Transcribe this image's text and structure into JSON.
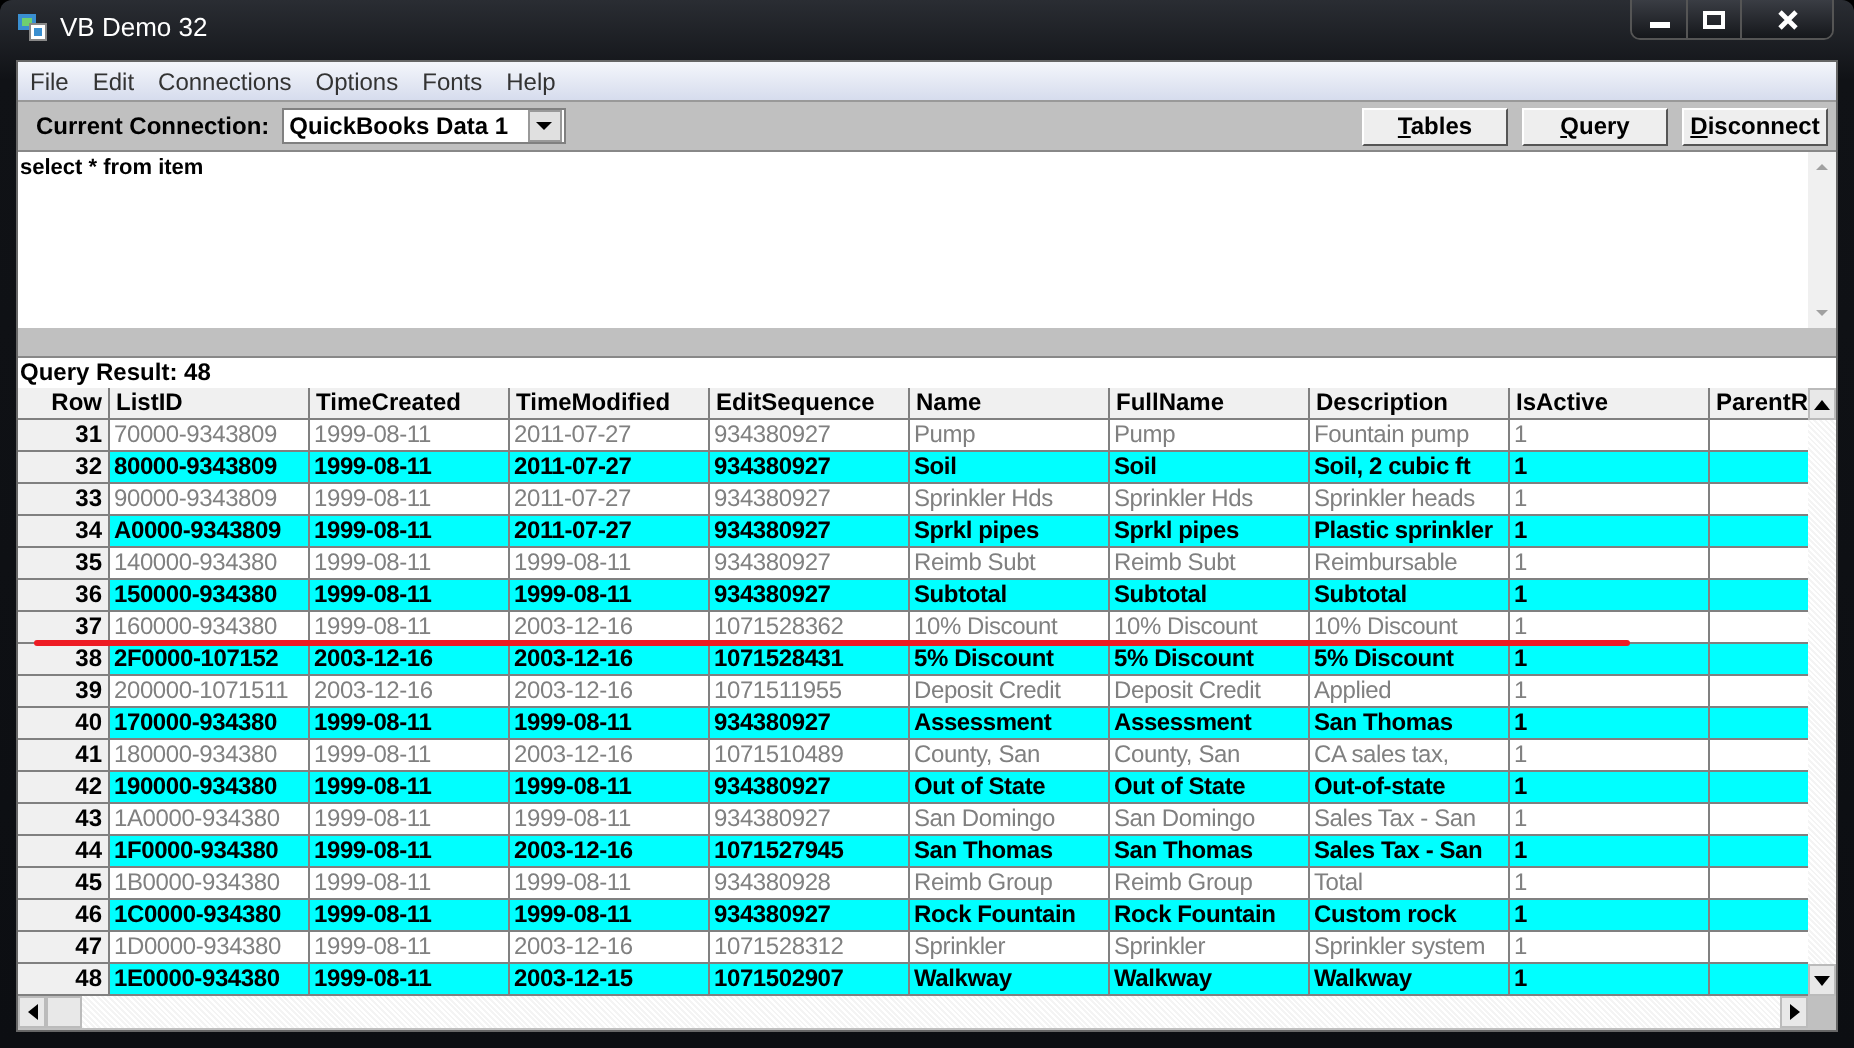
{
  "window": {
    "title": "VB Demo 32"
  },
  "menu": [
    "File",
    "Edit",
    "Connections",
    "Options",
    "Fonts",
    "Help"
  ],
  "toolbar": {
    "connection_label": "Current Connection:",
    "connection": "QuickBooks Data 1",
    "buttons": [
      "Tables",
      "Query",
      "Disconnect"
    ]
  },
  "query": {
    "value": "select * from item"
  },
  "result_label": "Query Result: 48",
  "table": {
    "columns": [
      "Row",
      "ListID",
      "TimeCreated",
      "TimeModified",
      "EditSequence",
      "Name",
      "FullName",
      "Description",
      "IsActive",
      "ParentR"
    ],
    "rows": [
      {
        "cells": [
          "31",
          "70000-9343809",
          "1999-08-11",
          "2011-07-27",
          "934380927",
          "Pump",
          "Pump",
          "Fountain pump",
          "1"
        ],
        "highlighted": false,
        "underlined": false
      },
      {
        "cells": [
          "32",
          "80000-9343809",
          "1999-08-11",
          "2011-07-27",
          "934380927",
          "Soil",
          "Soil",
          "Soil, 2 cubic ft",
          "1"
        ],
        "highlighted": true,
        "underlined": false
      },
      {
        "cells": [
          "33",
          "90000-9343809",
          "1999-08-11",
          "2011-07-27",
          "934380927",
          "Sprinkler Hds",
          "Sprinkler Hds",
          "Sprinkler heads",
          "1"
        ],
        "highlighted": false,
        "underlined": false
      },
      {
        "cells": [
          "34",
          "A0000-9343809",
          "1999-08-11",
          "2011-07-27",
          "934380927",
          "Sprkl pipes",
          "Sprkl pipes",
          "Plastic sprinkler",
          "1"
        ],
        "highlighted": true,
        "underlined": false
      },
      {
        "cells": [
          "35",
          "140000-934380",
          "1999-08-11",
          "1999-08-11",
          "934380927",
          "Reimb Subt",
          "Reimb Subt",
          "Reimbursable",
          "1"
        ],
        "highlighted": false,
        "underlined": false
      },
      {
        "cells": [
          "36",
          "150000-934380",
          "1999-08-11",
          "1999-08-11",
          "934380927",
          "Subtotal",
          "Subtotal",
          "Subtotal",
          "1"
        ],
        "highlighted": true,
        "underlined": false
      },
      {
        "cells": [
          "37",
          "160000-934380",
          "1999-08-11",
          "2003-12-16",
          "1071528362",
          "10% Discount",
          "10% Discount",
          "10% Discount",
          "1"
        ],
        "highlighted": false,
        "underlined": true
      },
      {
        "cells": [
          "38",
          "2F0000-107152",
          "2003-12-16",
          "2003-12-16",
          "1071528431",
          "5% Discount",
          "5% Discount",
          "5% Discount",
          "1"
        ],
        "highlighted": true,
        "underlined": false
      },
      {
        "cells": [
          "39",
          "200000-1071511",
          "2003-12-16",
          "2003-12-16",
          "1071511955",
          "Deposit Credit",
          "Deposit Credit",
          "Applied",
          "1"
        ],
        "highlighted": false,
        "underlined": false
      },
      {
        "cells": [
          "40",
          "170000-934380",
          "1999-08-11",
          "1999-08-11",
          "934380927",
          "Assessment",
          "Assessment",
          "San Thomas",
          "1"
        ],
        "highlighted": true,
        "underlined": false
      },
      {
        "cells": [
          "41",
          "180000-934380",
          "1999-08-11",
          "2003-12-16",
          "1071510489",
          "County, San",
          "County, San",
          "CA sales tax,",
          "1"
        ],
        "highlighted": false,
        "underlined": false
      },
      {
        "cells": [
          "42",
          "190000-934380",
          "1999-08-11",
          "1999-08-11",
          "934380927",
          "Out of State",
          "Out of State",
          "Out-of-state",
          "1"
        ],
        "highlighted": true,
        "underlined": false
      },
      {
        "cells": [
          "43",
          "1A0000-934380",
          "1999-08-11",
          "1999-08-11",
          "934380927",
          "San Domingo",
          "San Domingo",
          "Sales Tax - San",
          "1"
        ],
        "highlighted": false,
        "underlined": false
      },
      {
        "cells": [
          "44",
          "1F0000-934380",
          "1999-08-11",
          "2003-12-16",
          "1071527945",
          "San Thomas",
          "San Thomas",
          "Sales Tax - San",
          "1"
        ],
        "highlighted": true,
        "underlined": false
      },
      {
        "cells": [
          "45",
          "1B0000-934380",
          "1999-08-11",
          "1999-08-11",
          "934380928",
          "Reimb Group",
          "Reimb Group",
          "Total",
          "1"
        ],
        "highlighted": false,
        "underlined": false
      },
      {
        "cells": [
          "46",
          "1C0000-934380",
          "1999-08-11",
          "1999-08-11",
          "934380927",
          "Rock Fountain",
          "Rock Fountain",
          "Custom rock",
          "1"
        ],
        "highlighted": true,
        "underlined": false
      },
      {
        "cells": [
          "47",
          "1D0000-934380",
          "1999-08-11",
          "2003-12-16",
          "1071528312",
          "Sprinkler",
          "Sprinkler",
          "Sprinkler system",
          "1"
        ],
        "highlighted": false,
        "underlined": false
      },
      {
        "cells": [
          "48",
          "1E0000-934380",
          "1999-08-11",
          "2003-12-15",
          "1071502907",
          "Walkway",
          "Walkway",
          "Walkway",
          "1"
        ],
        "highlighted": true,
        "underlined": false
      }
    ]
  }
}
